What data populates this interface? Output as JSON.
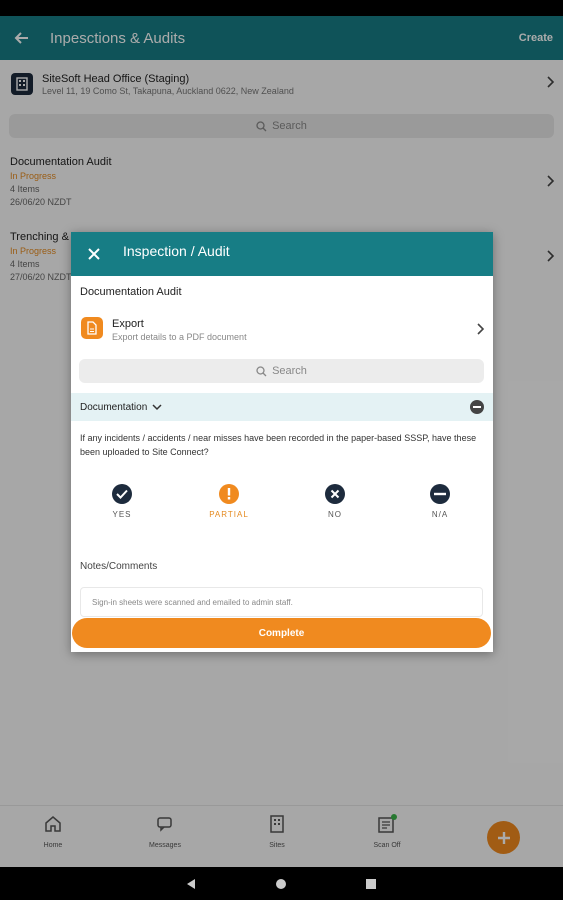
{
  "app_bar": {
    "title": "Inpesctions & Audits",
    "create_label": "Create"
  },
  "site": {
    "name": "SiteSoft Head Office (Staging)",
    "address": "Level 11, 19 Como St, Takapuna, Auckland 0622, New Zealand"
  },
  "search": {
    "placeholder": "Search"
  },
  "list": [
    {
      "title": "Documentation Audit",
      "status": "In Progress",
      "count": "4 Items",
      "date": "26/06/20 NZDT"
    },
    {
      "title": "Trenching &",
      "status": "In Progress",
      "count": "4 Items",
      "date": "27/06/20 NZDT"
    }
  ],
  "bottom_nav": {
    "items": [
      {
        "label": "Home",
        "icon": "home-icon"
      },
      {
        "label": "Messages",
        "icon": "messages-icon"
      },
      {
        "label": "Sites",
        "icon": "building-icon"
      },
      {
        "label": "Scan Off",
        "icon": "scan-icon"
      }
    ],
    "fab_icon": "plus-icon"
  },
  "dialog": {
    "title": "Inspection / Audit",
    "subtitle": "Documentation Audit",
    "export": {
      "title": "Export",
      "description": "Export details to a PDF document"
    },
    "search_placeholder": "Search",
    "section": "Documentation",
    "question": "If any incidents / accidents / near misses have been recorded in the paper-based SSSP, have these been uploaded to Site Connect?",
    "options": [
      {
        "label": "YES",
        "icon": "check-icon",
        "selected": false
      },
      {
        "label": "PARTIAL",
        "icon": "exclamation-icon",
        "selected": true
      },
      {
        "label": "NO",
        "icon": "x-icon",
        "selected": false
      },
      {
        "label": "N/A",
        "icon": "minus-icon",
        "selected": false
      }
    ],
    "notes_label": "Notes/Comments",
    "notes_value": "Sign-in sheets were scanned and emailed to admin staff.",
    "complete_label": "Complete"
  },
  "colors": {
    "primary": "#177d85",
    "accent": "#f08a1f",
    "dark": "#1d2b3d",
    "section_bg": "#e4f2f4"
  }
}
